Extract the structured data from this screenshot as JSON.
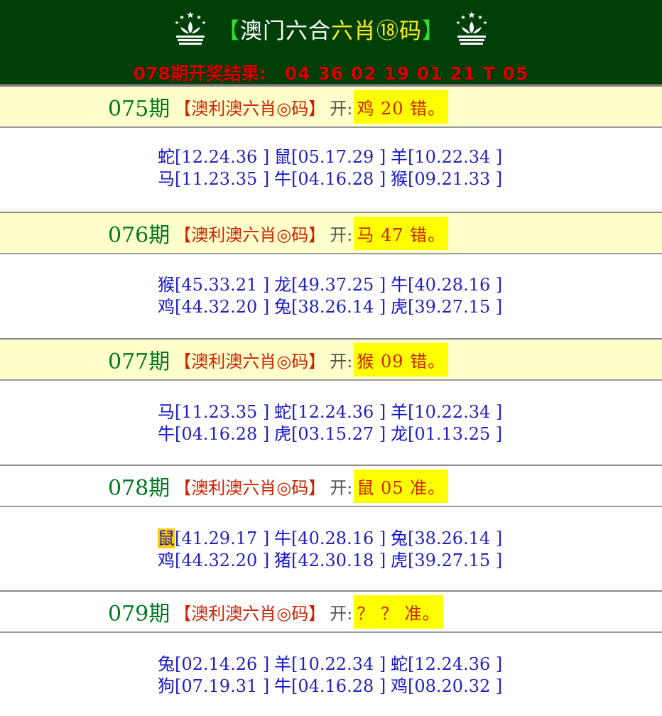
{
  "header": {
    "title_open": "【",
    "title_main": "澳门六合",
    "title_yellow": "六肖⑱码",
    "title_close": "】",
    "result_label": "078期开奖结果:",
    "result_numbers": "04 36 02 19 01 21 T 05",
    "logo_icon": "macau-lotus-emblem-icon"
  },
  "sections": [
    {
      "issue": "075期",
      "label": "【澳利澳六肖◎码】",
      "kai": "开:",
      "result": "鸡 20 错。",
      "rows": [
        [
          {
            "z": "蛇",
            "n": "[12.24.36 ]"
          },
          {
            "z": "鼠",
            "n": "[05.17.29 ]"
          },
          {
            "z": "羊",
            "n": "[10.22.34 ]"
          }
        ],
        [
          {
            "z": "马",
            "n": "[11.23.35 ]"
          },
          {
            "z": "牛",
            "n": "[04.16.28 ]"
          },
          {
            "z": "猴",
            "n": "[09.21.33 ]"
          }
        ]
      ]
    },
    {
      "issue": "076期",
      "label": "【澳利澳六肖◎码】",
      "kai": "开:",
      "result": "马 47 错。",
      "rows": [
        [
          {
            "z": "猴",
            "n": "[45.33.21 ]"
          },
          {
            "z": "龙",
            "n": "[49.37.25 ]"
          },
          {
            "z": "牛",
            "n": "[40.28.16 ]"
          }
        ],
        [
          {
            "z": "鸡",
            "n": "[44.32.20 ]"
          },
          {
            "z": "兔",
            "n": "[38.26.14 ]"
          },
          {
            "z": "虎",
            "n": "[39.27.15 ]"
          }
        ]
      ]
    },
    {
      "issue": "077期",
      "label": "【澳利澳六肖◎码】",
      "kai": "开:",
      "result": "猴 09 错。",
      "rows": [
        [
          {
            "z": "马",
            "n": "[11.23.35 ]"
          },
          {
            "z": "蛇",
            "n": "[12.24.36 ]"
          },
          {
            "z": "羊",
            "n": "[10.22.34 ]"
          }
        ],
        [
          {
            "z": "牛",
            "n": "[04.16.28 ]"
          },
          {
            "z": "虎",
            "n": "[03.15.27 ]"
          },
          {
            "z": "龙",
            "n": "[01.13.25 ]"
          }
        ]
      ]
    },
    {
      "issue": "078期",
      "label": "【澳利澳六肖◎码】",
      "kai": "开:",
      "result": "鼠 05 准。",
      "rows": [
        [
          {
            "z": "鼠",
            "n": "[41.29.17 ]",
            "hit": true
          },
          {
            "z": "牛",
            "n": "[40.28.16 ]"
          },
          {
            "z": "兔",
            "n": "[38.26.14 ]"
          }
        ],
        [
          {
            "z": "鸡",
            "n": "[44.32.20 ]"
          },
          {
            "z": "猪",
            "n": "[42.30.18 ]"
          },
          {
            "z": "虎",
            "n": "[39.27.15 ]"
          }
        ]
      ]
    },
    {
      "issue": "079期",
      "label": "【澳利澳六肖◎码】",
      "kai": "开:",
      "result": "？ ？ 准。",
      "rows": [
        [
          {
            "z": "兔",
            "n": "[02.14.26 ]"
          },
          {
            "z": "羊",
            "n": "[10.22.34 ]"
          },
          {
            "z": "蛇",
            "n": "[12.24.36 ]"
          }
        ],
        [
          {
            "z": "狗",
            "n": "[07.19.31 ]"
          },
          {
            "z": "牛",
            "n": "[04.16.28 ]"
          },
          {
            "z": "鸡",
            "n": "[08.20.32 ]"
          }
        ]
      ]
    }
  ],
  "colors": {
    "header_bg": "#004008",
    "title_bracket": "#33dd33",
    "title_highlight": "#ffee22",
    "result_red": "#d80000",
    "issue_green": "#007722",
    "label_red": "#cc2200",
    "zodiac_blue": "#1414cc",
    "highlight_yellow": "#ffff00",
    "hit_bg": "#ffcc00",
    "section_head_bg": "#ffffcc"
  }
}
